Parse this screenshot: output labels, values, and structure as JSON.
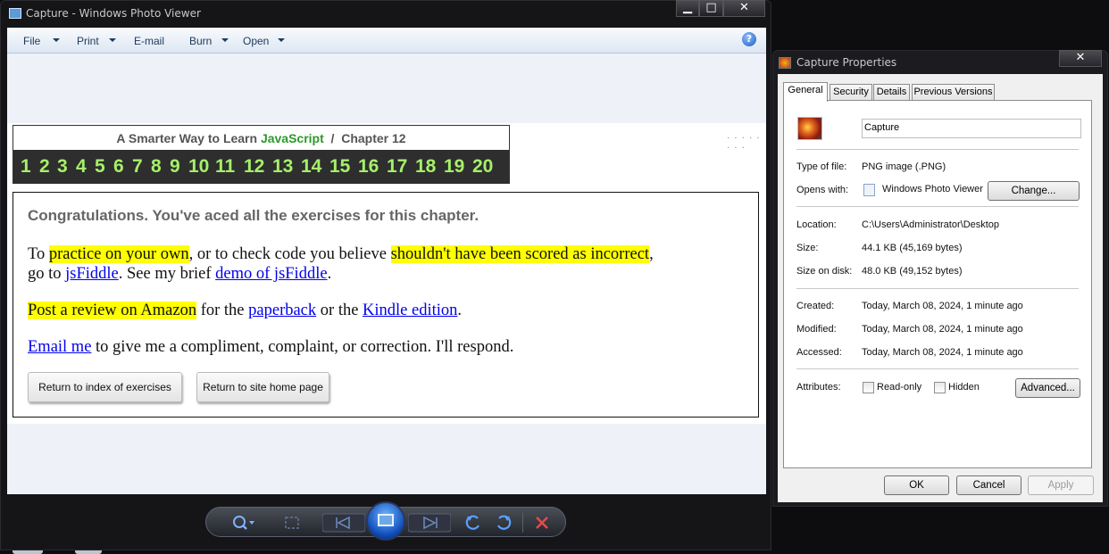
{
  "viewer": {
    "title": "Capture - Windows Photo Viewer",
    "menu": [
      "File",
      "Print",
      "E-mail",
      "Burn",
      "Open"
    ],
    "help_glyph": "?",
    "caption_buttons": {
      "minimize": "▁",
      "maximize": "□",
      "close": "✕"
    }
  },
  "page": {
    "header_prefix": "A Smarter Way to Learn ",
    "header_js": "JavaScript",
    "header_suffix": "  /  Chapter 12",
    "chapters": [
      "1",
      "2",
      "3",
      "4",
      "5",
      "6",
      "7",
      "8",
      "9",
      "10",
      "11",
      "12",
      "13",
      "14",
      "15",
      "16",
      "17",
      "18",
      "19",
      "20"
    ],
    "dots": "· · · · · · · ·",
    "congrats": "Congratulations. You've aced all the exercises for this chapter.",
    "p1_a": "To ",
    "p1_hl1": "practice on your own",
    "p1_b": ", or to check code you believe ",
    "p1_hl2": "shouldn't have been scored as incorrect",
    "p1_c": ",",
    "p2_a": "go to ",
    "p2_link1": "jsFiddle",
    "p2_b": ". See my brief ",
    "p2_link2": "demo of jsFiddle",
    "p2_c": ".",
    "p3_hl": "Post a review on Amazon",
    "p3_a": " for the ",
    "p3_link1": "paperback",
    "p3_b": " or the ",
    "p3_link2": "Kindle edition",
    "p3_c": ".",
    "p4_link": "Email me",
    "p4_a": " to give me a compliment, complaint, or correction. I'll respond.",
    "btn_index": "Return to index of exercises",
    "btn_home": "Return to site home page"
  },
  "controls": [
    "zoom-icon",
    "fit-icon",
    "previous-icon",
    "slideshow-icon",
    "next-icon",
    "rotate-ccw-icon",
    "rotate-cw-icon",
    "delete-icon"
  ],
  "props": {
    "title": "Capture Properties",
    "close": "✕",
    "tabs": [
      "General",
      "Security",
      "Details",
      "Previous Versions"
    ],
    "name": "Capture",
    "type_label": "Type of file:",
    "type_value": "PNG image (.PNG)",
    "opens_label": "Opens with:",
    "opens_value": "Windows Photo Viewer",
    "change_btn": "Change...",
    "location_label": "Location:",
    "location_value": "C:\\Users\\Administrator\\Desktop",
    "size_label": "Size:",
    "size_value": "44.1 KB (45,169 bytes)",
    "size_disk_label": "Size on disk:",
    "size_disk_value": "48.0 KB (49,152 bytes)",
    "created_label": "Created:",
    "created_value": "Today, March 08, 2024, 1 minute ago",
    "modified_label": "Modified:",
    "modified_value": "Today, March 08, 2024, 1 minute ago",
    "accessed_label": "Accessed:",
    "accessed_value": "Today, March 08, 2024, 1 minute ago",
    "attributes_label": "Attributes:",
    "readonly_label": "Read-only",
    "hidden_label": "Hidden",
    "advanced_btn": "Advanced...",
    "ok_btn": "OK",
    "cancel_btn": "Cancel",
    "apply_btn": "Apply"
  }
}
